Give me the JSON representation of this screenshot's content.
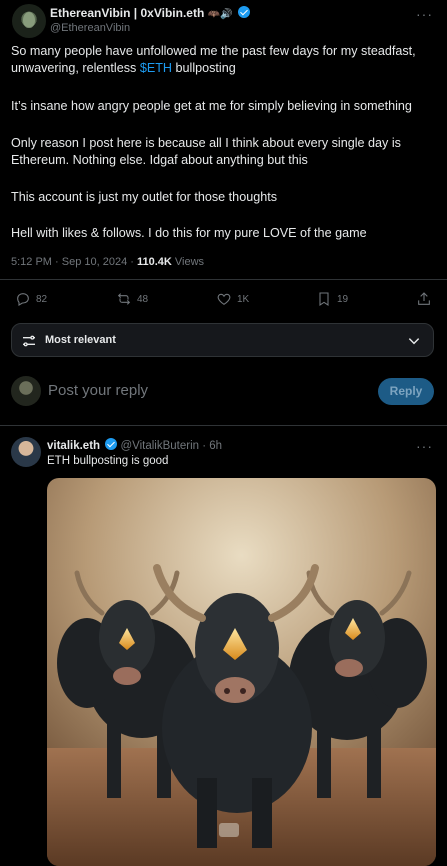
{
  "tweet": {
    "author_name": "EthereanVibin | 0xVibin.eth",
    "author_emoji": "🦇🔊",
    "author_handle": "@EthereanVibin",
    "para1_a": "So many people have unfollowed me the past few days for my steadfast,",
    "para1_b": "unwavering, relentless ",
    "cashtag": "$ETH",
    "para1_c": " bullposting",
    "para2": "It’s insane how angry people get at me for simply believing in something",
    "para3_a": "Only reason I post here is because all I think about every single day is",
    "para3_b": "Ethereum. Nothing else. Idgaf about anything but this",
    "para4": "This account is just my outlet for those thoughts",
    "para5": "Hell with likes & follows. I do this for my pure LOVE of the game",
    "timestamp": "5:12 PM · Sep 10, 2024 · ",
    "views_count": "110.4K",
    "views_label": " Views",
    "more": "···"
  },
  "actions": {
    "replies": "82",
    "reposts": "48",
    "likes": "1K",
    "bookmarks": "19"
  },
  "sort": {
    "label": "Most relevant"
  },
  "composer": {
    "placeholder": "Post your reply",
    "button": "Reply"
  },
  "reply": {
    "name": "vitalik.eth",
    "handle": "@VitalikButerin",
    "time": "· 6h",
    "text": "ETH bullposting is good",
    "more": "···"
  },
  "colors": {
    "accent": "#1d9bf0",
    "background": "#000000",
    "divider": "#2f3336"
  },
  "icons": [
    "reply-icon",
    "repost-icon",
    "like-icon",
    "bookmark-icon",
    "share-icon",
    "sort-icon",
    "chevron-down-icon",
    "verified-icon"
  ]
}
